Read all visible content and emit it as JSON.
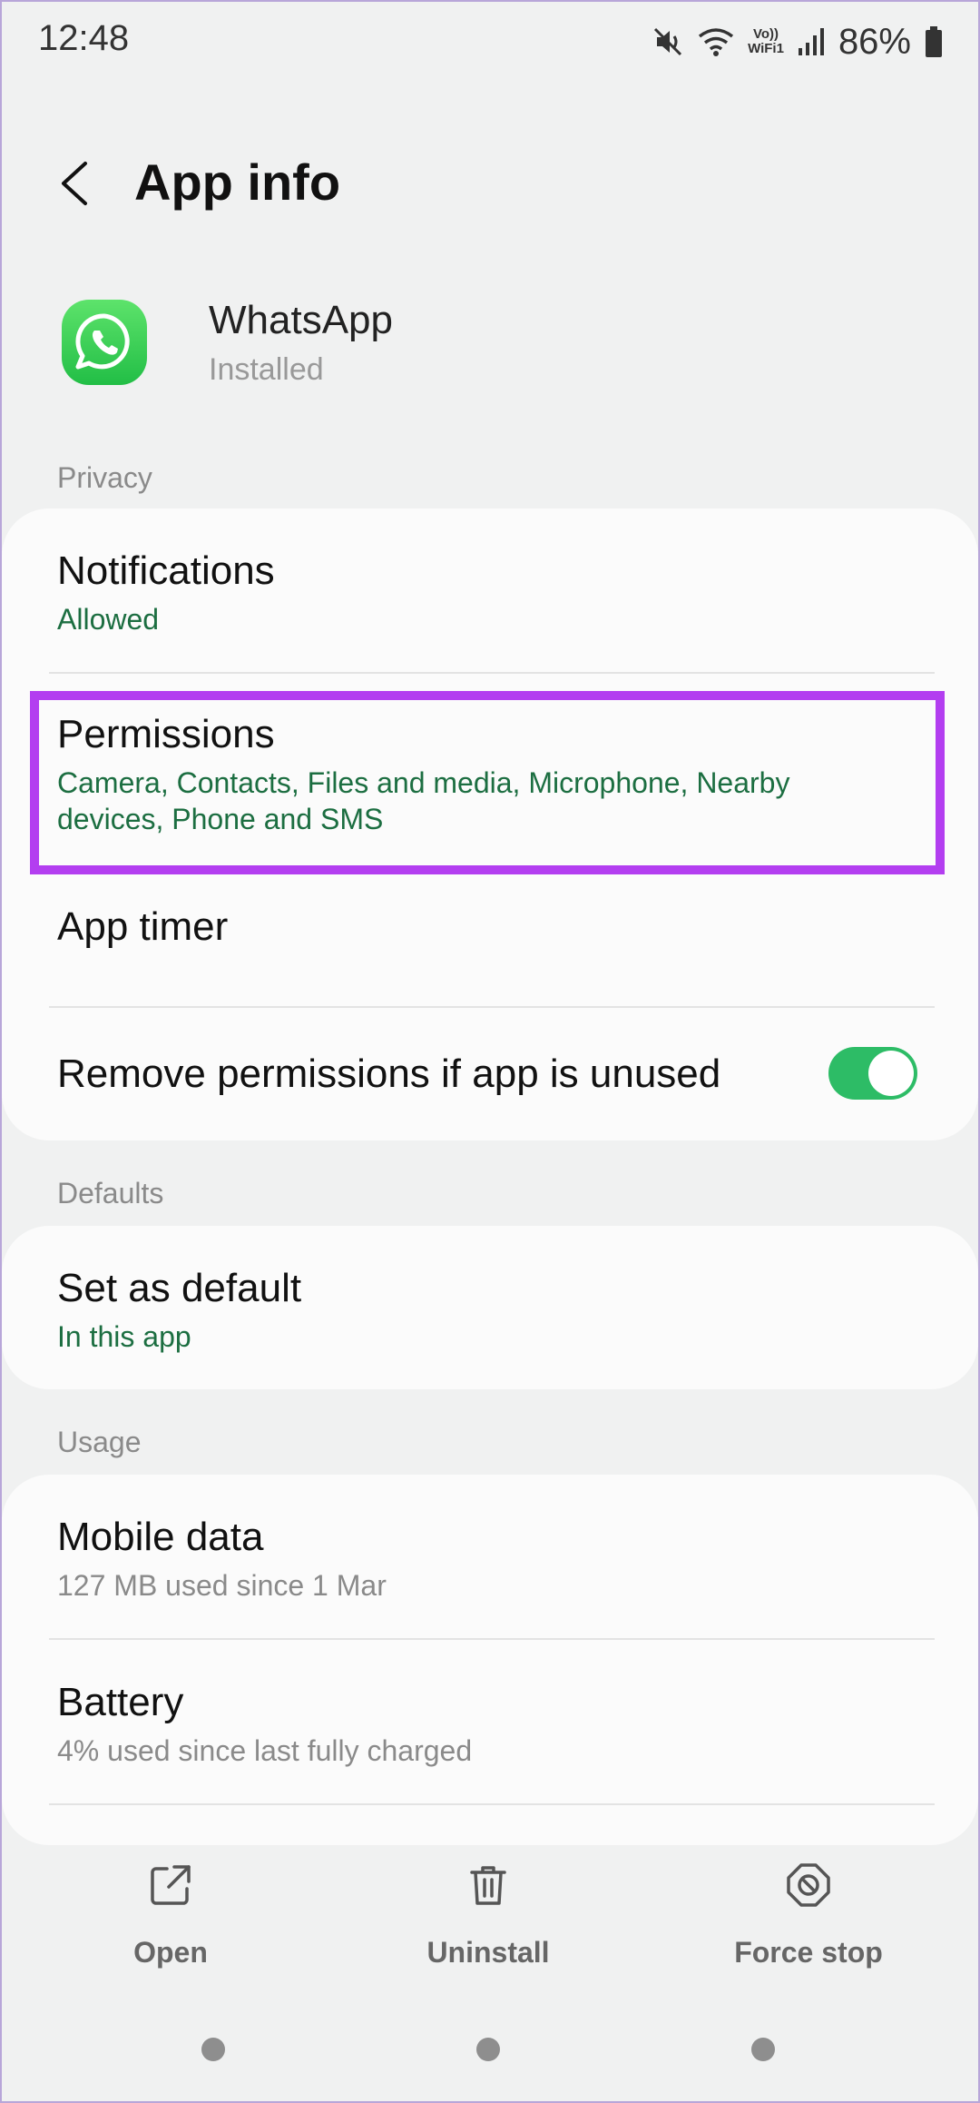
{
  "status_bar": {
    "time": "12:48",
    "volte_top": "Vo))",
    "volte_bottom": "WiFi1",
    "battery": "86%"
  },
  "header": {
    "title": "App info"
  },
  "app": {
    "name": "WhatsApp",
    "status": "Installed",
    "icon": "whatsapp-icon"
  },
  "sections": {
    "privacy": {
      "label": "Privacy",
      "notifications": {
        "title": "Notifications",
        "subtitle": "Allowed"
      },
      "permissions": {
        "title": "Permissions",
        "subtitle_line1": "Camera, Contacts, Files and media, Microphone, Nearby",
        "subtitle_line2": "devices, Phone and SMS"
      },
      "app_timer": {
        "title": "App timer"
      },
      "remove_permissions": {
        "title": "Remove permissions if app is unused",
        "enabled": true
      }
    },
    "defaults": {
      "label": "Defaults",
      "set_as_default": {
        "title": "Set as default",
        "subtitle": "In this app"
      }
    },
    "usage": {
      "label": "Usage",
      "mobile_data": {
        "title": "Mobile data",
        "subtitle": "127 MB used since 1 Mar"
      },
      "battery": {
        "title": "Battery",
        "subtitle": "4% used since last fully charged"
      }
    }
  },
  "actions": {
    "open": "Open",
    "uninstall": "Uninstall",
    "force_stop": "Force stop"
  },
  "colors": {
    "accent_green": "#1c6e41",
    "toggle_on": "#2dbc66",
    "highlight": "#b33ef0"
  }
}
